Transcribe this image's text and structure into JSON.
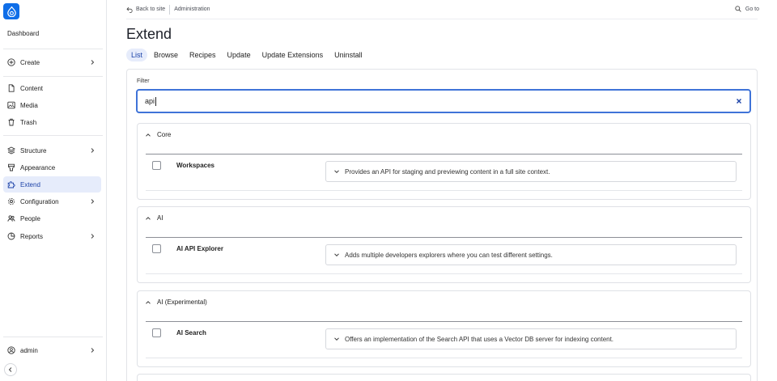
{
  "sidebar": {
    "dashboard": "Dashboard",
    "items": [
      {
        "label": "Create",
        "icon": "plus-circle-icon",
        "chevron": true
      },
      {
        "label": "Content",
        "icon": "document-icon",
        "chevron": false
      },
      {
        "label": "Media",
        "icon": "image-icon",
        "chevron": false
      },
      {
        "label": "Trash",
        "icon": "trash-icon",
        "chevron": false
      },
      {
        "label": "Structure",
        "icon": "layers-icon",
        "chevron": true
      },
      {
        "label": "Appearance",
        "icon": "brush-icon",
        "chevron": false
      },
      {
        "label": "Extend",
        "icon": "puzzle-icon",
        "chevron": false,
        "active": true
      },
      {
        "label": "Configuration",
        "icon": "gear-icon",
        "chevron": true
      },
      {
        "label": "People",
        "icon": "people-icon",
        "chevron": false
      },
      {
        "label": "Reports",
        "icon": "pie-chart-icon",
        "chevron": true
      }
    ],
    "user": {
      "label": "admin",
      "icon": "user-circle-icon"
    }
  },
  "topbar": {
    "back": "Back to site",
    "crumb": "Administration",
    "goto": "Go to"
  },
  "page": {
    "title": "Extend",
    "tabs": [
      {
        "label": "List",
        "active": true
      },
      {
        "label": "Browse"
      },
      {
        "label": "Recipes"
      },
      {
        "label": "Update"
      },
      {
        "label": "Update Extensions"
      },
      {
        "label": "Uninstall"
      }
    ]
  },
  "filter": {
    "label": "Filter",
    "value": "api"
  },
  "groups": [
    {
      "title": "Core",
      "modules": [
        {
          "name": "Workspaces",
          "description": "Provides an API for staging and previewing content in a full site context."
        }
      ]
    },
    {
      "title": "AI",
      "modules": [
        {
          "name": "AI API Explorer",
          "description": "Adds multiple developers explorers where you can test different settings."
        }
      ]
    },
    {
      "title": "AI (Experimental)",
      "modules": [
        {
          "name": "AI Search",
          "description": "Offers an implementation of the Search API that uses a Vector DB server for indexing content."
        }
      ]
    }
  ],
  "colors": {
    "brand": "#0f6ee8",
    "accent": "#3f73d8",
    "active_bg": "#e6ecfb",
    "active_text": "#1d43a8"
  }
}
